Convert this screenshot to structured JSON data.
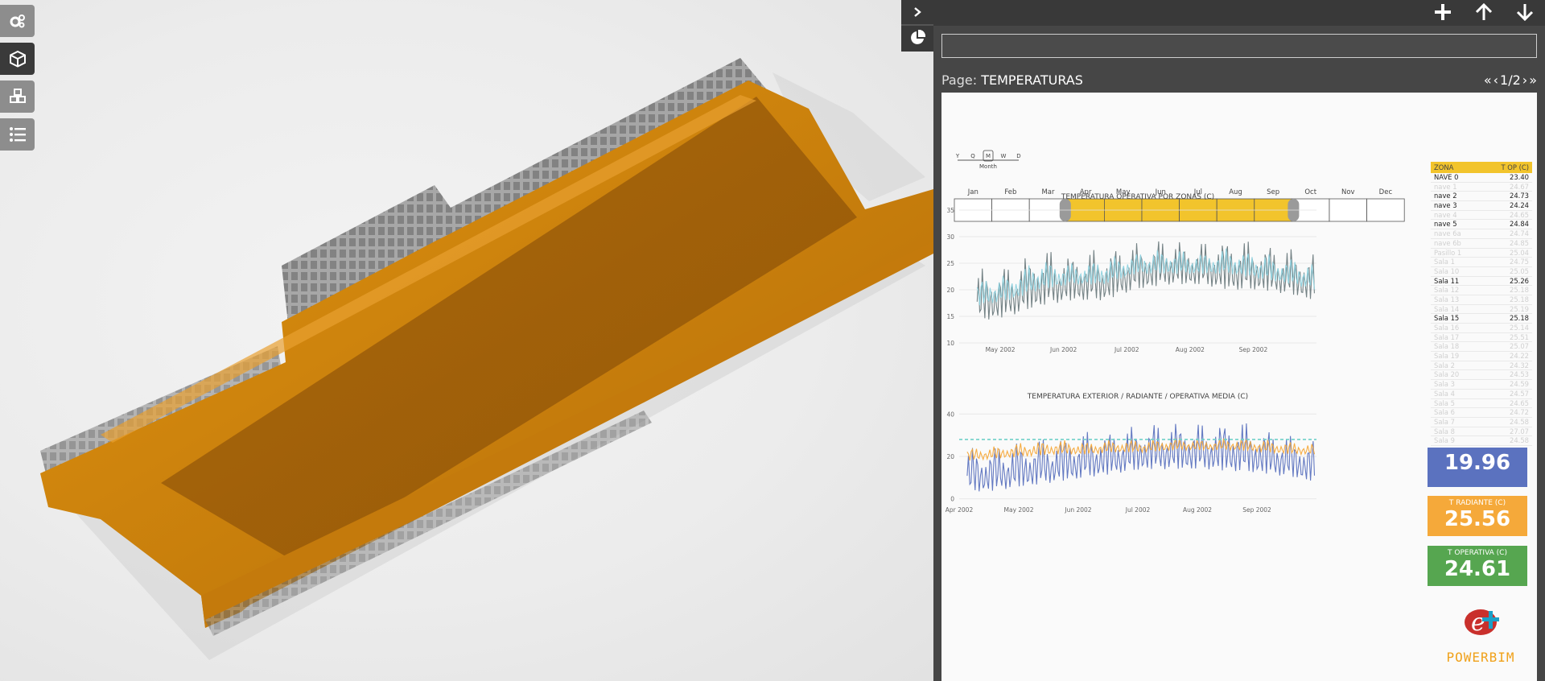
{
  "colors": {
    "model": "#d98a10",
    "model_dark": "#a9660a",
    "accent_yellow": "#f2c42c",
    "kpi_blue": "#5b72bf",
    "kpi_orange": "#f5a93a",
    "kpi_green": "#56a650"
  },
  "toolbar": {
    "buttons": [
      {
        "name": "settings-icon"
      },
      {
        "name": "cube-icon"
      },
      {
        "name": "cubes-icon"
      },
      {
        "name": "list-icon"
      }
    ]
  },
  "panel": {
    "sidebar": {
      "expand_icon": "chevron-right-icon",
      "report_icon": "pie-chart-icon"
    },
    "top_icons": [
      "plus-icon",
      "arrow-up-icon",
      "arrow-down-icon"
    ],
    "search": {
      "value": "",
      "placeholder": ""
    },
    "page_label": "Page:",
    "page_name": "TEMPERATURAS",
    "page_counter": "1/2"
  },
  "report": {
    "time_slicer": {
      "levels": [
        "Y",
        "Q",
        "M",
        "W",
        "D"
      ],
      "active_level": "M",
      "level_caption": "Month",
      "months": [
        "Jan",
        "Feb",
        "Mar",
        "Apr",
        "May",
        "Jun",
        "Jul",
        "Aug",
        "Sep",
        "Oct",
        "Nov",
        "Dec"
      ],
      "selected": [
        "Apr",
        "May",
        "Jun",
        "Jul",
        "Aug",
        "Sep"
      ]
    },
    "zone_table": {
      "headers": [
        "ZONA",
        "T OP (C)"
      ],
      "rows": [
        {
          "zona": "NAVE 0",
          "t": "23.40",
          "dim": false
        },
        {
          "zona": "nave 1",
          "t": "24.67",
          "dim": true
        },
        {
          "zona": "nave 2",
          "t": "24.73",
          "dim": false
        },
        {
          "zona": "nave 3",
          "t": "24.24",
          "dim": false
        },
        {
          "zona": "nave 4",
          "t": "24.65",
          "dim": true
        },
        {
          "zona": "nave 5",
          "t": "24.84",
          "dim": false
        },
        {
          "zona": "nave 6a",
          "t": "24.74",
          "dim": true
        },
        {
          "zona": "nave 6b",
          "t": "24.85",
          "dim": true
        },
        {
          "zona": "Pasillo 1",
          "t": "25.04",
          "dim": true
        },
        {
          "zona": "Sala 1",
          "t": "24.75",
          "dim": true
        },
        {
          "zona": "Sala 10",
          "t": "25.05",
          "dim": true
        },
        {
          "zona": "Sala 11",
          "t": "25.26",
          "dim": false
        },
        {
          "zona": "Sala 12",
          "t": "25.18",
          "dim": true
        },
        {
          "zona": "Sala 13",
          "t": "25.18",
          "dim": true
        },
        {
          "zona": "Sala 14",
          "t": "25.19",
          "dim": true
        },
        {
          "zona": "Sala 15",
          "t": "25.18",
          "dim": false
        },
        {
          "zona": "Sala 16",
          "t": "25.14",
          "dim": true
        },
        {
          "zona": "Sala 17",
          "t": "25.51",
          "dim": true
        },
        {
          "zona": "Sala 18",
          "t": "25.07",
          "dim": true
        },
        {
          "zona": "Sala 19",
          "t": "24.22",
          "dim": true
        },
        {
          "zona": "Sala 2",
          "t": "24.32",
          "dim": true
        },
        {
          "zona": "Sala 20",
          "t": "24.53",
          "dim": true
        },
        {
          "zona": "Sala 3",
          "t": "24.59",
          "dim": true
        },
        {
          "zona": "Sala 4",
          "t": "24.57",
          "dim": true
        },
        {
          "zona": "Sala 5",
          "t": "24.65",
          "dim": true
        },
        {
          "zona": "Sala 6",
          "t": "24.72",
          "dim": true
        },
        {
          "zona": "Sala 7",
          "t": "24.58",
          "dim": true
        },
        {
          "zona": "Sala 8",
          "t": "27.07",
          "dim": true
        },
        {
          "zona": "Sala 9",
          "t": "24.58",
          "dim": true
        }
      ]
    },
    "kpis": [
      {
        "label": "",
        "value": "19.96",
        "color": "#5b72bf"
      },
      {
        "label": "T RADIANTE (C)",
        "value": "25.56",
        "color": "#f5a93a"
      },
      {
        "label": "T OPERATIVA (C)",
        "value": "24.61",
        "color": "#56a650"
      }
    ],
    "logo_text": "POWERBIM"
  },
  "chart_data": [
    {
      "type": "line",
      "title": "TEMPERATURA OPERATIVA POR ZONAS (C)",
      "x_ticks": [
        "May 2002",
        "Jun 2002",
        "Jul 2002",
        "Aug 2002",
        "Sep 2002"
      ],
      "y_ticks": [
        10,
        15,
        20,
        25,
        30,
        35
      ],
      "ylim": [
        10,
        35
      ],
      "series": [
        {
          "color": "#6d7b7e",
          "x": [
            "Apr 20",
            "May 5",
            "May 20",
            "Jun 5",
            "Jun 20",
            "Jul 5",
            "Jul 20",
            "Aug 5",
            "Aug 20",
            "Sep 5",
            "Sep 20",
            "Sep 30"
          ],
          "low": [
            14,
            15,
            17,
            18,
            18,
            20,
            21,
            21,
            20,
            20,
            19,
            18
          ],
          "high": [
            24,
            25,
            28,
            27,
            28,
            29,
            30,
            29,
            30,
            29,
            28,
            27
          ]
        },
        {
          "color": "#8fd3e0",
          "x": [
            "Apr 20",
            "May 5",
            "May 20",
            "Jun 5",
            "Jun 20",
            "Jul 5",
            "Jul 20",
            "Aug 5",
            "Aug 20",
            "Sep 5",
            "Sep 20",
            "Sep 30"
          ],
          "low": [
            17,
            18,
            20,
            21,
            21,
            23,
            23,
            23,
            23,
            22,
            21,
            20
          ],
          "high": [
            22,
            23,
            26,
            25,
            26,
            27,
            28,
            27,
            28,
            27,
            26,
            25
          ]
        }
      ]
    },
    {
      "type": "line",
      "title": "TEMPERATURA EXTERIOR / RADIANTE / OPERATIVA MEDIA (C)",
      "x_ticks": [
        "Apr 2002",
        "May 2002",
        "Jun 2002",
        "Jul 2002",
        "Aug 2002",
        "Sep 2002"
      ],
      "y_ticks": [
        0,
        20,
        40
      ],
      "ylim": [
        -2,
        42
      ],
      "series": [
        {
          "color": "#5b72bf",
          "x": [
            "Apr 5",
            "Apr 20",
            "May 5",
            "May 20",
            "Jun 5",
            "Jun 20",
            "Jul 5",
            "Jul 20",
            "Aug 5",
            "Aug 20",
            "Sep 5",
            "Sep 20",
            "Sep 30"
          ],
          "low": [
            3,
            4,
            6,
            8,
            10,
            12,
            14,
            14,
            14,
            13,
            12,
            10,
            8
          ],
          "high": [
            24,
            26,
            28,
            30,
            32,
            33,
            36,
            37,
            36,
            38,
            34,
            30,
            28
          ]
        },
        {
          "color": "#f5a93a",
          "x": [
            "Apr 5",
            "Apr 20",
            "May 5",
            "May 20",
            "Jun 5",
            "Jun 20",
            "Jul 5",
            "Jul 20",
            "Aug 5",
            "Aug 20",
            "Sep 5",
            "Sep 20",
            "Sep 30"
          ],
          "low": [
            18,
            19,
            20,
            21,
            21,
            22,
            22,
            23,
            23,
            23,
            22,
            21,
            21
          ],
          "high": [
            24,
            25,
            27,
            28,
            27,
            28,
            28,
            29,
            28,
            29,
            28,
            27,
            26
          ]
        },
        {
          "color": "#6fd0c8",
          "dashed": true,
          "constant": 28
        }
      ]
    }
  ]
}
